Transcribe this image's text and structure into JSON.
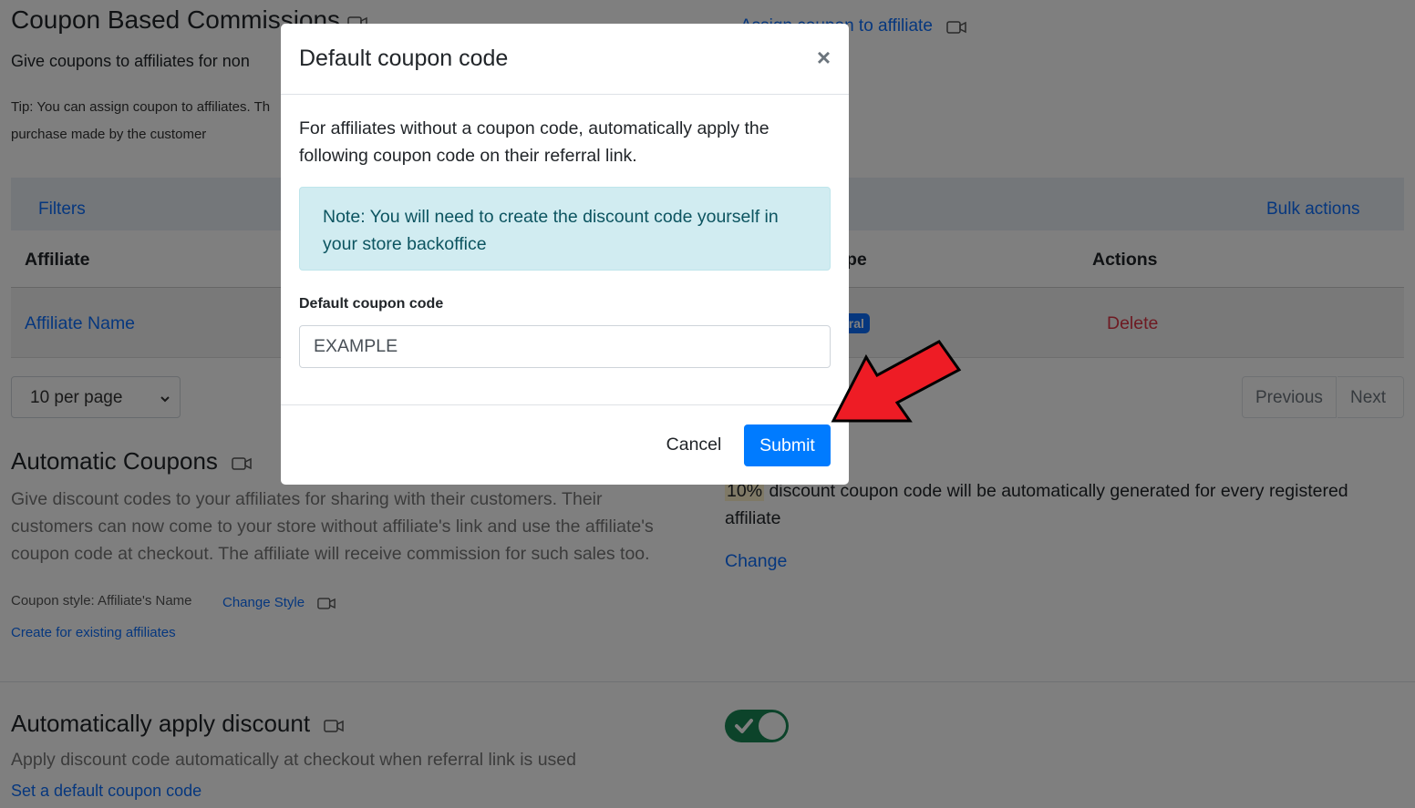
{
  "coupon_commissions": {
    "title": "Coupon Based Commissions",
    "subtitle": "Give coupons to affiliates for non",
    "tip_line1": "Tip: You can assign coupon to affiliates. Th",
    "tip_line2": "purchase made by the customer",
    "assign_link": "Assign coupon to affiliate"
  },
  "table": {
    "filters_label": "Filters",
    "bulk_actions_label": "Bulk actions",
    "headers": {
      "affiliate": "Affiliate",
      "type_partial": "pe",
      "actions": "Actions"
    },
    "row": {
      "affiliate_name": "Affiliate Name",
      "type_badge": "Referral",
      "delete_label": "Delete"
    }
  },
  "pagination": {
    "per_page": "10 per page",
    "previous_label": "Previous",
    "next_label": "Next"
  },
  "automatic_coupons": {
    "title": "Automatic Coupons",
    "description": "Give discount codes to your affiliates for sharing with their customers. Their customers can now come to your store without affiliate's link and use the affiliate's coupon code at checkout. The affiliate will receive commission for such sales too.",
    "coupon_style": "Coupon style: Affiliate's Name",
    "change_style_label": "Change Style",
    "create_existing_label": "Create for existing affiliates",
    "discount_value": "10%",
    "discount_text_line1": "discount coupon code will be automatically generated for every registered",
    "discount_text_line2": "affiliate",
    "change_label": "Change"
  },
  "auto_apply": {
    "title": "Automatically apply discount",
    "description": "Apply discount code automatically at checkout when referral link is used",
    "set_default_label": "Set a default coupon code",
    "toggle_on": true
  },
  "modal": {
    "title": "Default coupon code",
    "close_symbol": "×",
    "body_text": "For affiliates without a coupon code, automatically apply the following coupon code on their referral link.",
    "note": "Note: You will need to create the discount code yourself in your store backoffice",
    "field_label": "Default coupon code",
    "field_value": "EXAMPLE",
    "cancel_label": "Cancel",
    "submit_label": "Submit"
  },
  "colors": {
    "primary": "#007bff",
    "danger": "#dc3545",
    "success": "#198754",
    "alert_bg": "#d1ecf1",
    "arrow": "#ee1c25"
  }
}
